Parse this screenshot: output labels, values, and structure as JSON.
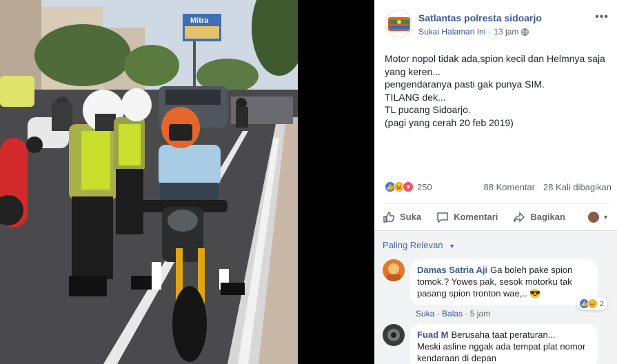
{
  "post": {
    "page_name": "Satlantas polresta sidoarjo",
    "like_page": "Sukai Halaman Ini",
    "time": "13 jam",
    "lines": [
      "Motor nopol tidak ada,spion kecil dan Helmnya saja",
      "yang keren...",
      "pengendaranya pasti gak punya SIM.",
      "TILANG dek...",
      "TL pucang Sidoarjo.",
      "(pagi yang cerah 20 feb 2019)"
    ],
    "reaction_count": "250",
    "comments_count": "88 Komentar",
    "shares_count": "28 Kali dibagikan"
  },
  "actions": {
    "like": "Suka",
    "comment": "Komentari",
    "share": "Bagikan"
  },
  "comments_section": {
    "sort_label": "Paling Relevan"
  },
  "comments": [
    {
      "author": "Damas Satria Aji",
      "text_line1": "Ga boleh pake spion",
      "text_line2": "tomok.? Yowes pak, sesok motorku tak",
      "text_line3": "pasang spion tronton wae,..",
      "like": "Suka",
      "reply": "Balas",
      "time": "5 jam",
      "reaction_count": "2"
    },
    {
      "author": "Fuad M",
      "text_line1": "Berusaha taat peraturan...",
      "text_line2": "Meski asline nggak ada tempat plat nomor",
      "text_line3": "kendaraan di depan"
    }
  ],
  "photo_text": {
    "billboard": "Mitra"
  },
  "colors": {
    "facebook_blue": "#385898",
    "like_reaction": "#3578e5",
    "love_reaction": "#f25268",
    "haha_reaction": "#f7b125"
  }
}
